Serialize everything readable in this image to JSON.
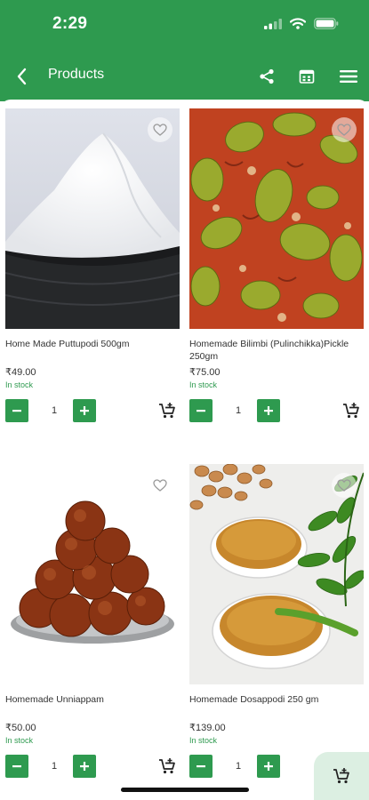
{
  "status_bar": {
    "time": "2:29"
  },
  "header": {
    "title": "Products"
  },
  "products": [
    {
      "name": "Home Made Puttupodi  500gm",
      "price": "₹49.00",
      "stock": "In stock",
      "qty": "1"
    },
    {
      "name": "Homemade Bilimbi (Pulinchikka)Pickle 250gm",
      "price": "₹75.00",
      "stock": "In stock",
      "qty": "1"
    },
    {
      "name": "Homemade Unniappam",
      "price": "₹50.00",
      "stock": "In stock",
      "qty": "1"
    },
    {
      "name": "Homemade Dosappodi 250 gm",
      "price": "₹139.00",
      "stock": "In stock",
      "qty": "1"
    }
  ],
  "colors": {
    "primary": "#2e9a4f",
    "float_cart_bg": "#dcefe2",
    "text": "#333333"
  },
  "icons": [
    "back-arrow-icon",
    "share-icon",
    "calendar-icon",
    "menu-icon",
    "heart-icon",
    "minus-icon",
    "plus-icon",
    "add-cart-icon",
    "cart-icon"
  ]
}
